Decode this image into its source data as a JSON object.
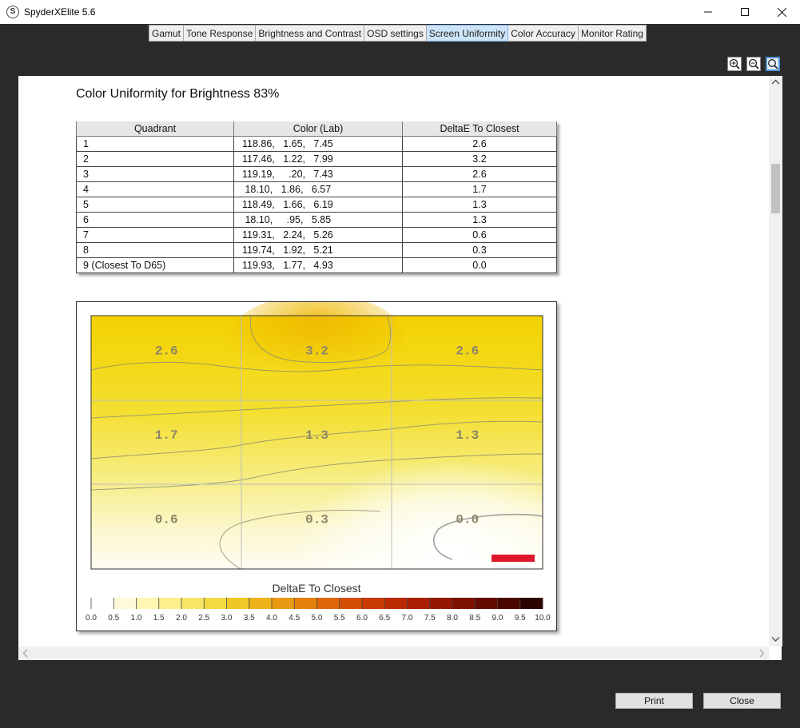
{
  "window": {
    "title": "SpyderXElite 5.6",
    "app_icon_letter": "S"
  },
  "tabs": [
    {
      "label": "Gamut"
    },
    {
      "label": "Tone Response"
    },
    {
      "label": "Brightness and Contrast"
    },
    {
      "label": "OSD settings"
    },
    {
      "label": "Screen Uniformity",
      "active": true
    },
    {
      "label": "Color Accuracy"
    },
    {
      "label": "Monitor Rating"
    }
  ],
  "report": {
    "title": "Color Uniformity for Brightness 83%",
    "table": {
      "headers": [
        "Quadrant",
        "Color (Lab)",
        "DeltaE To Closest"
      ],
      "rows": [
        [
          "1",
          "118.86,   1.65,   7.45",
          "2.6"
        ],
        [
          "2",
          "117.46,   1.22,   7.99",
          "3.2"
        ],
        [
          "3",
          "119.19,     .20,   7.43",
          "2.6"
        ],
        [
          "4",
          " 18.10,   1.86,   6.57",
          "1.7"
        ],
        [
          "5",
          "118.49,   1.66,   6.19",
          "1.3"
        ],
        [
          "6",
          " 18.10,     .95,   5.85",
          "1.3"
        ],
        [
          "7",
          "119.31,   2.24,   5.26",
          "0.6"
        ],
        [
          "8",
          "119.74,   1.92,   5.21",
          "0.3"
        ],
        [
          "9 (Closest To D65)",
          "119.93,   1.77,   4.93",
          "0.0"
        ]
      ]
    }
  },
  "chart_data": {
    "type": "heatmap",
    "grid": [
      [
        2.6,
        3.2,
        2.6
      ],
      [
        1.7,
        1.3,
        1.3
      ],
      [
        0.6,
        0.3,
        0.0
      ]
    ],
    "legend_title": "DeltaE To Closest",
    "legend_ticks": [
      "0.0",
      "0.5",
      "1.0",
      "1.5",
      "2.0",
      "2.5",
      "3.0",
      "3.5",
      "4.0",
      "4.5",
      "5.0",
      "5.5",
      "6.0",
      "6.5",
      "7.0",
      "7.5",
      "8.0",
      "8.5",
      "9.0",
      "9.5",
      "10.0"
    ],
    "legend_colors": [
      "#ffffff",
      "#fffbd9",
      "#fff6b2",
      "#fdef8c",
      "#f8e565",
      "#f4d944",
      "#f0c825",
      "#edb11a",
      "#e99912",
      "#e4800c",
      "#de6608",
      "#d44e05",
      "#c93a03",
      "#bb2a02",
      "#a91e01",
      "#951600",
      "#7e1000",
      "#640b00",
      "#4a0700",
      "#2d0300"
    ],
    "marker_color": "#e0182d"
  },
  "footer": {
    "print_label": "Print",
    "close_label": "Close"
  }
}
